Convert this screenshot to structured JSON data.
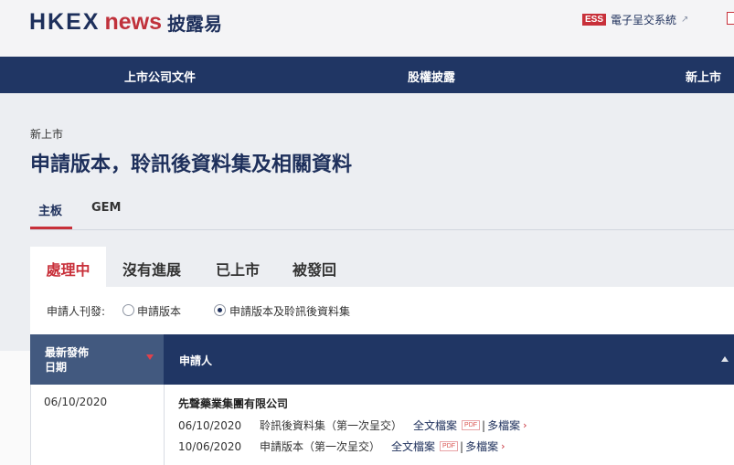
{
  "header": {
    "logo_hkex": "HKEX",
    "logo_news": "news",
    "logo_cn": "披露易",
    "ess_badge": "ESS",
    "ess_label": "電子呈交系統"
  },
  "nav": {
    "items": [
      "上市公司文件",
      "股權披露",
      "新上市"
    ]
  },
  "breadcrumb": "新上市",
  "page_title": "申請版本，聆訊後資料集及相關資料",
  "board_tabs": [
    {
      "label": "主板",
      "active": true
    },
    {
      "label": "GEM",
      "active": false
    }
  ],
  "status_tabs": [
    {
      "label": "處理中",
      "active": true
    },
    {
      "label": "沒有進展",
      "active": false
    },
    {
      "label": "已上市",
      "active": false
    },
    {
      "label": "被發回",
      "active": false
    }
  ],
  "filter": {
    "label": "申請人刊發:",
    "options": [
      {
        "label": "申請版本",
        "checked": false
      },
      {
        "label": "申請版本及聆訊後資料集",
        "checked": true
      }
    ]
  },
  "table": {
    "headers": {
      "date_line1": "最新發佈",
      "date_line2": "日期",
      "applicant": "申請人"
    },
    "rows": [
      {
        "date": "06/10/2020",
        "company": "先聲藥業集團有限公司",
        "docs": [
          {
            "date": "06/10/2020",
            "type": "聆訊後資料集（第一次呈交）",
            "full_text": "全文檔案",
            "pdf": "PDF",
            "multi": "多檔案"
          },
          {
            "date": "10/06/2020",
            "type": "申請版本（第一次呈交）",
            "full_text": "全文檔案",
            "pdf": "PDF",
            "multi": "多檔案"
          }
        ]
      }
    ]
  },
  "colors": {
    "navy": "#203664",
    "accent_red": "#c8303a",
    "sorted_column": "#42597f"
  }
}
